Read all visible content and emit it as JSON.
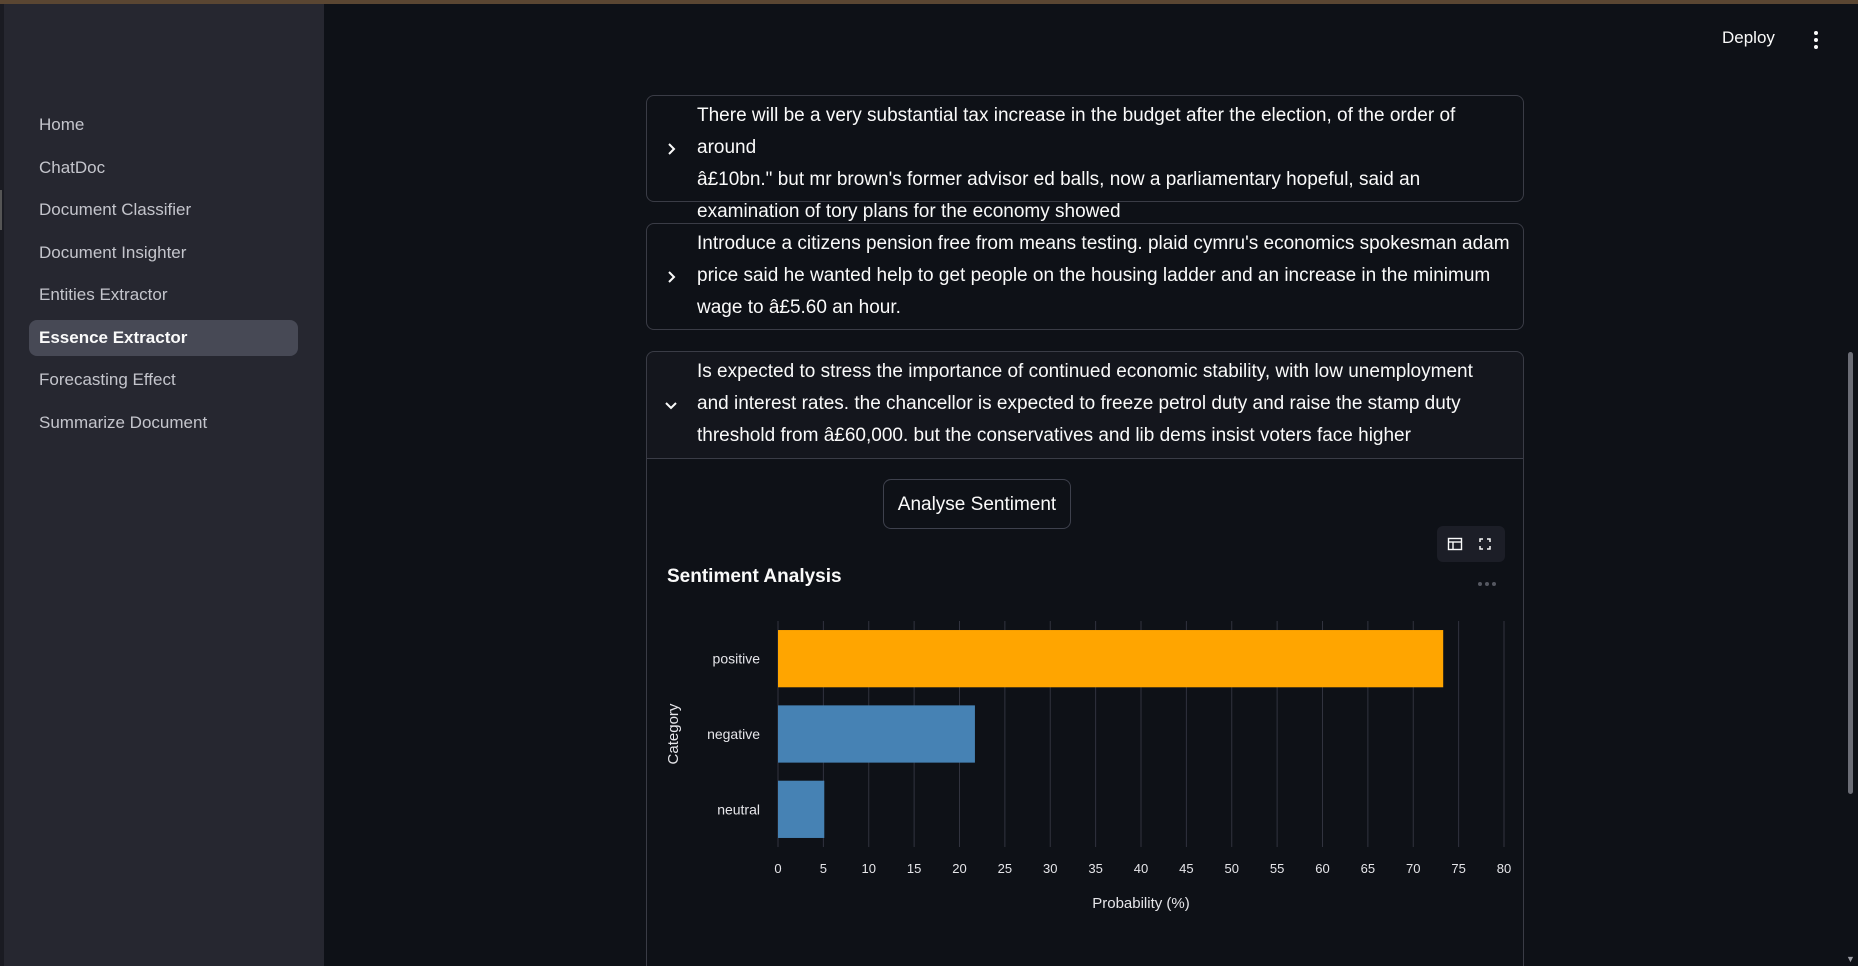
{
  "sidebar": {
    "items": [
      {
        "label": "Home",
        "active": false
      },
      {
        "label": "ChatDoc",
        "active": false
      },
      {
        "label": "Document Classifier",
        "active": false
      },
      {
        "label": "Document Insighter",
        "active": false
      },
      {
        "label": "Entities Extractor",
        "active": false
      },
      {
        "label": "Essence Extractor",
        "active": true
      },
      {
        "label": "Forecasting Effect",
        "active": false
      },
      {
        "label": "Summarize Document",
        "active": false
      }
    ]
  },
  "header": {
    "deploy_label": "Deploy",
    "menu_icon": "vertical-dots-icon"
  },
  "expanders": [
    {
      "expanded": false,
      "lines": [
        "There will be a very substantial tax increase in the budget after the election, of the order of around",
        "â£10bn.\" but mr brown's former advisor ed balls, now a parliamentary hopeful, said an",
        "examination of tory plans for the economy showed"
      ]
    },
    {
      "expanded": false,
      "lines": [
        "Introduce a citizens pension free from means testing. plaid cymru's economics spokesman adam",
        "price said he wanted help to get people on the housing ladder and an increase in the minimum",
        "wage to â£5.60 an hour."
      ]
    },
    {
      "expanded": true,
      "lines": [
        "Is expected to stress the importance of continued economic stability, with low unemployment",
        "and interest rates. the chancellor is expected to freeze petrol duty and raise the stamp duty",
        "threshold from â£60,000. but the conservatives and lib dems insist voters face higher"
      ]
    }
  ],
  "analyse_button_label": "Analyse Sentiment",
  "chart_tools": {
    "table_icon": "table-icon",
    "fullscreen_icon": "fullscreen-icon",
    "more_icon": "more-horizontal-icon"
  },
  "chart_data": {
    "type": "bar",
    "orientation": "horizontal",
    "title": "Sentiment Analysis",
    "xlabel": "Probability (%)",
    "ylabel": "Category",
    "categories": [
      "positive",
      "negative",
      "neutral"
    ],
    "values": [
      73.3,
      21.7,
      5.1
    ],
    "colors": [
      "#ffa500",
      "#4682b4",
      "#4682b4"
    ],
    "xlim": [
      0,
      80
    ],
    "xticks": [
      0,
      5,
      10,
      15,
      20,
      25,
      30,
      35,
      40,
      45,
      50,
      55,
      60,
      65,
      70,
      75,
      80
    ],
    "grid": true
  }
}
